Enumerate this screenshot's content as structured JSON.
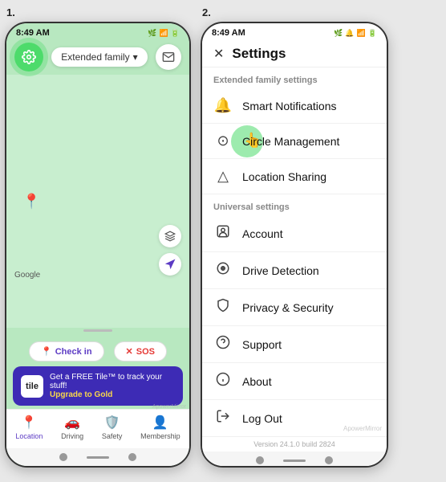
{
  "panel1": {
    "number": "1.",
    "statusBar": {
      "time": "8:49 AM",
      "icons": "🔋📶"
    },
    "familySelector": {
      "label": "Extended family",
      "arrow": "▾"
    },
    "mapLabel": "Google",
    "actionBar": {
      "checkin": "Check in",
      "sos": "SOS"
    },
    "promo": {
      "tileLogo": "tile",
      "line1": "Get a FREE Tile™ to track your stuff!",
      "line2": "Upgrade to Gold"
    },
    "bottomNav": [
      {
        "icon": "📍",
        "label": "Location",
        "active": true
      },
      {
        "icon": "🚗",
        "label": "Driving",
        "active": false
      },
      {
        "icon": "🛡️",
        "label": "Safety",
        "active": false
      },
      {
        "icon": "👤",
        "label": "Membership",
        "active": false
      }
    ]
  },
  "panel2": {
    "number": "2.",
    "statusBar": {
      "time": "8:49 AM",
      "icons": "🔋📶"
    },
    "header": {
      "closeIcon": "✕",
      "title": "Settings"
    },
    "sections": [
      {
        "label": "Extended family settings",
        "items": [
          {
            "icon": "🔔",
            "label": "Smart Notifications"
          },
          {
            "icon": "⊙",
            "label": "Circle Management",
            "highlighted": true
          },
          {
            "icon": "△",
            "label": "Location Sharing"
          }
        ]
      },
      {
        "label": "Universal settings",
        "items": [
          {
            "icon": "👤",
            "label": "Account"
          },
          {
            "icon": "🚗",
            "label": "Drive Detection"
          },
          {
            "icon": "🔒",
            "label": "Privacy & Security"
          },
          {
            "icon": "❓",
            "label": "Support"
          },
          {
            "icon": "ℹ️",
            "label": "About"
          },
          {
            "icon": "↩",
            "label": "Log Out"
          }
        ]
      }
    ],
    "version": "Version 24.1.0 build 2824",
    "watermark": "ApowerMirror"
  }
}
